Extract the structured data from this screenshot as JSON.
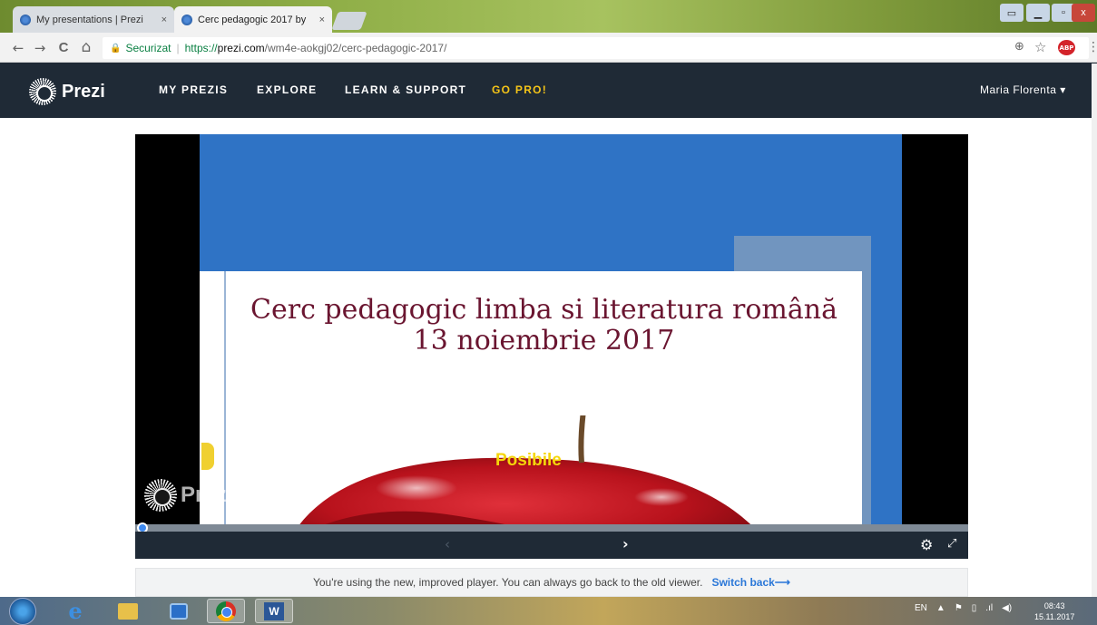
{
  "browser": {
    "tabs": [
      {
        "title": "My presentations | Prezi",
        "close": "×"
      },
      {
        "title": "Cerc pedagogic 2017 by",
        "close": "×"
      }
    ],
    "window_controls": {
      "min": "▭",
      "restore": "▁",
      "max": "▫",
      "close": "x"
    },
    "nav": {
      "back": "←",
      "forward": "→",
      "reload": "C",
      "home": "⌂"
    },
    "address": {
      "lock": "🔒",
      "security_label": "Securizat",
      "separator": "|",
      "scheme": "https://",
      "host": "prezi.com",
      "path": "/wm4e-aokgj02/cerc-pedagogic-2017/"
    },
    "toolbar": {
      "zoom": "⊕",
      "star": "☆",
      "ext_label": "ABP",
      "menu": "⋮"
    }
  },
  "prezi_header": {
    "logo_text": "Prezi",
    "nav": [
      "MY PREZIS",
      "EXPLORE",
      "LEARN & SUPPORT",
      "GO PRO!"
    ],
    "user": "Maria Florenta ▾"
  },
  "slide": {
    "title_line1": "Cerc pedagogic limba si literatura română",
    "title_line2": "13 noiembrie 2017",
    "apple_text": "Posibile",
    "watermark": "Prezi"
  },
  "player_controls": {
    "prev": "‹",
    "next": "›",
    "settings": "⚙",
    "fullscreen": "⤢",
    "progress_fraction": 0.0
  },
  "notice": {
    "text": "You're using the new, improved player. You can always go back to the old viewer.",
    "link": "Switch back⟶"
  },
  "taskbar": {
    "tray_lang": "EN",
    "tray_icons": [
      "▲",
      "⚑",
      "▯",
      ".ıl",
      "◀)"
    ],
    "time": "08:43",
    "date": "15.11.2017",
    "word_label": "W"
  }
}
